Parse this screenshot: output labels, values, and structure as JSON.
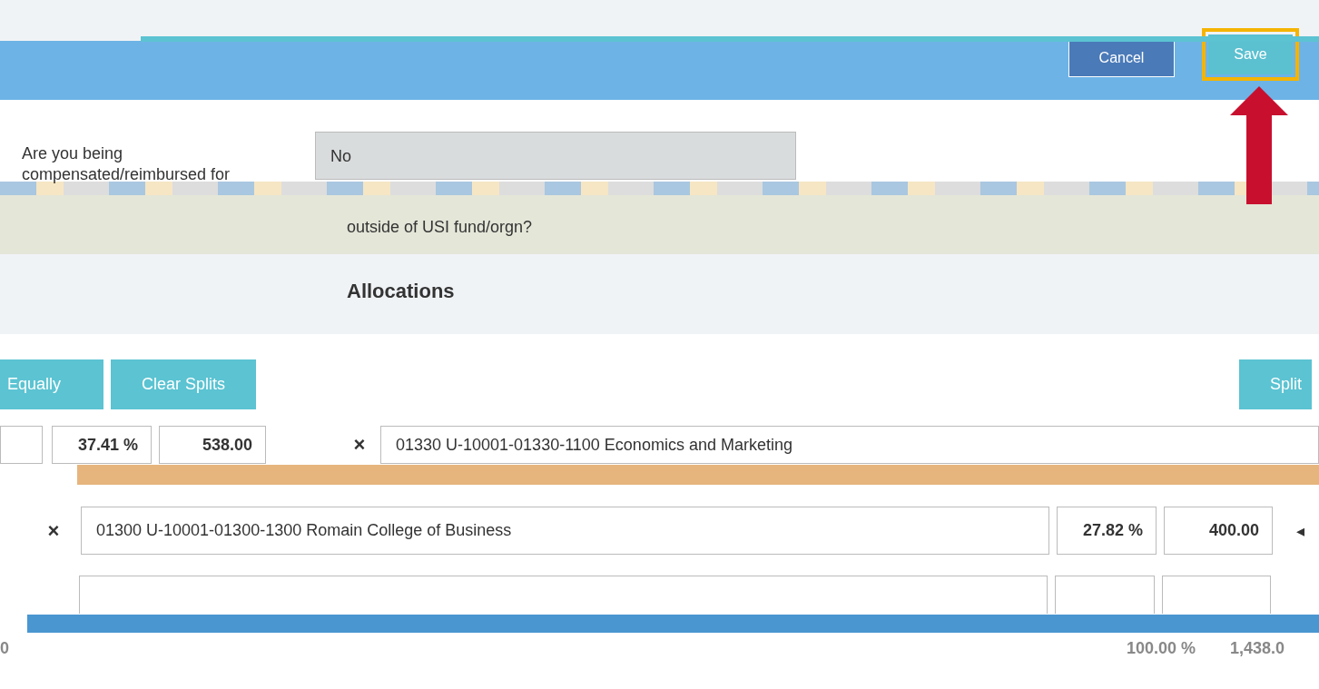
{
  "header": {
    "buttons": [
      {
        "label": "Cancel",
        "kind": "secondary",
        "highlighted": false
      },
      {
        "label": "Save",
        "kind": "primary",
        "highlighted": true
      }
    ]
  },
  "question": {
    "label": "Are you being compensated/reimbursed for",
    "value": "No",
    "continuation": "outside of USI fund/orgn?"
  },
  "allocations": {
    "title": "Allocations",
    "actions": [
      "Equally",
      "Clear Splits"
    ],
    "split_button": "Split",
    "rows": [
      {
        "kind": "offset",
        "percent": "37.41 %",
        "amount": "538.00",
        "remove": "×",
        "account": "01330 U-10001-01330-1100 Economics and Marketing"
      },
      {
        "kind": "full",
        "remove": "×",
        "account": "01300 U-10001-01300-1300 Romain College of Business",
        "percent": "27.82 %",
        "amount": "400.00",
        "caret": "◂"
      },
      {
        "kind": "obscured"
      }
    ],
    "totals": {
      "column_1": "0",
      "percent": "100.00 %",
      "amount": "1,438.0"
    }
  }
}
